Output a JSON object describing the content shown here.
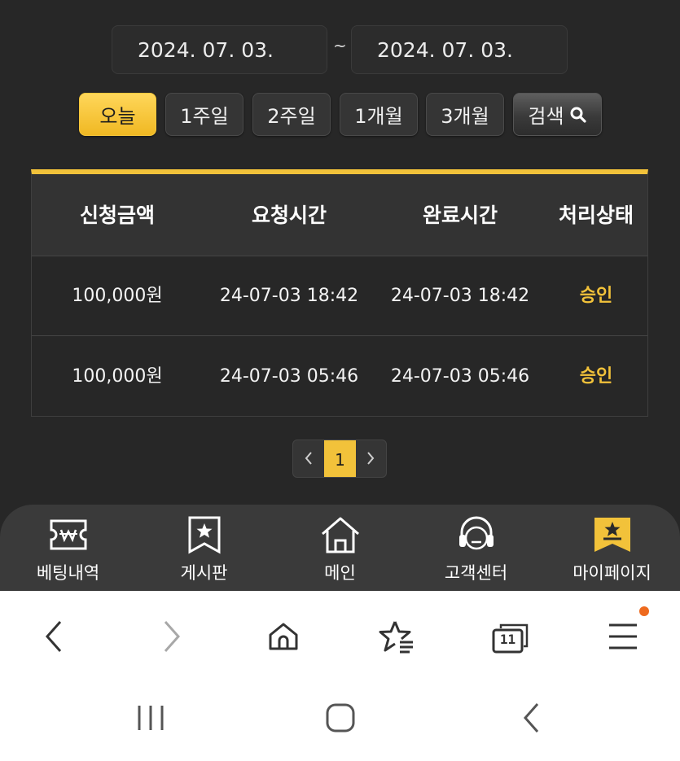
{
  "date_range": {
    "from": "2024. 07. 03.",
    "separator": "~",
    "to": "2024. 07. 03."
  },
  "period_buttons": [
    {
      "label": "오늘",
      "active": true
    },
    {
      "label": "1주일",
      "active": false
    },
    {
      "label": "2주일",
      "active": false
    },
    {
      "label": "1개월",
      "active": false
    },
    {
      "label": "3개월",
      "active": false
    }
  ],
  "search_button": {
    "label": "검색",
    "icon": "search-icon"
  },
  "table": {
    "headers": [
      "신청금액",
      "요청시간",
      "완료시간",
      "처리상태"
    ],
    "rows": [
      {
        "amount": "100,000원",
        "requested": "24-07-03 18:42",
        "completed": "24-07-03 18:42",
        "status": "승인"
      },
      {
        "amount": "100,000원",
        "requested": "24-07-03 05:46",
        "completed": "24-07-03 05:46",
        "status": "승인"
      }
    ]
  },
  "pagination": {
    "current": "1"
  },
  "bottom_nav": [
    {
      "label": "베팅내역",
      "icon": "betting-ticket-icon"
    },
    {
      "label": "게시판",
      "icon": "bookmark-star-icon"
    },
    {
      "label": "메인",
      "icon": "home-icon"
    },
    {
      "label": "고객센터",
      "icon": "headset-icon"
    },
    {
      "label": "마이페이지",
      "icon": "my-page-star-icon",
      "active": true
    }
  ],
  "browser_toolbar": {
    "tabs_count": "11",
    "icons": [
      "back-icon",
      "forward-icon",
      "home-icon",
      "bookmarks-icon",
      "tabs-icon",
      "menu-icon"
    ]
  },
  "colors": {
    "accent": "#f2c23a",
    "background": "#272727",
    "nav_background": "#3a3a3a",
    "notification_dot": "#ee6a1e"
  }
}
